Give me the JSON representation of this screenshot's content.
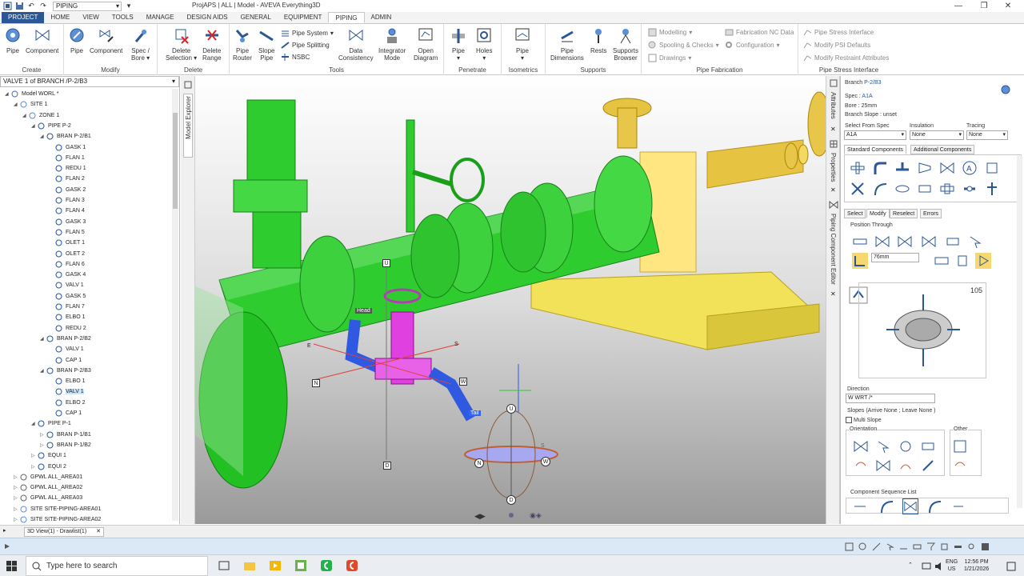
{
  "window": {
    "title": "ProjAPS | ALL | Model - AVEVA Everything3D",
    "module_combo": "PIPING"
  },
  "tabs": [
    "PROJECT",
    "HOME",
    "VIEW",
    "TOOLS",
    "MANAGE",
    "DESIGN AIDS",
    "GENERAL",
    "EQUIPMENT",
    "PIPING",
    "ADMIN"
  ],
  "active_tab": "PIPING",
  "ribbon": {
    "create": {
      "label": "Create",
      "pipe": "Pipe",
      "component": "Component"
    },
    "modify": {
      "label": "Modify",
      "pipe": "Pipe",
      "component": "Component",
      "spec_bore": "Spec /\nBore ▾"
    },
    "delete": {
      "label": "Delete",
      "delete_selection": "Delete\nSelection ▾",
      "delete_range": "Delete\nRange"
    },
    "tools": {
      "label": "Tools",
      "pipe_router": "Pipe\nRouter",
      "slope_pipe": "Slope\nPipe",
      "pipe_system": "Pipe System",
      "pipe_splitting": "Pipe Splitting",
      "nsbc": "NSBC",
      "data_consistency": "Data\nConsistency",
      "integrator_mode": "Integrator\nMode",
      "open_diagram": "Open\nDiagram"
    },
    "penetrate": {
      "label": "Penetrate",
      "pipe": "Pipe\n▾",
      "holes": "Holes\n▾"
    },
    "isometrics": {
      "label": "Isometrics",
      "pipe": "Pipe\n▾"
    },
    "supports": {
      "label": "Supports",
      "pipe_dimensions": "Pipe\nDimensions",
      "rests": "Rests",
      "supports_browser": "Supports\nBrowser"
    },
    "fabrication": {
      "label": "Pipe Fabrication",
      "modelling": "Modelling",
      "spooling": "Spooling & Checks",
      "drawings": "Drawings",
      "fabrication_nc": "Fabrication NC Data",
      "configuration": "Configuration"
    },
    "stress": {
      "label": "Pipe Stress Interface",
      "pipe_stress_interface": "Pipe Stress Interface",
      "modify_psi_defaults": "Modify PSI Defaults",
      "modify_restraint": "Modify Restraint Attributes"
    }
  },
  "explorer": {
    "header": "VALVE 1 of BRANCH /P-2/B3",
    "vertical_label": "Model Explorer",
    "nodes": [
      {
        "label": "Model WORL *",
        "depth": 0,
        "toggle": "◢",
        "icon": "globe"
      },
      {
        "label": "SITE 1",
        "depth": 1,
        "toggle": "◢",
        "icon": "site"
      },
      {
        "label": "ZONE 1",
        "depth": 2,
        "toggle": "◢",
        "icon": "zone"
      },
      {
        "label": "PIPE P-2",
        "depth": 3,
        "toggle": "◢",
        "icon": "pipe"
      },
      {
        "label": "BRAN P-2/B1",
        "depth": 4,
        "toggle": "◢",
        "icon": "branch"
      },
      {
        "label": "GASK 1",
        "depth": 5,
        "toggle": "",
        "icon": "gask"
      },
      {
        "label": "FLAN 1",
        "depth": 5,
        "toggle": "",
        "icon": "flan"
      },
      {
        "label": "REDU 1",
        "depth": 5,
        "toggle": "",
        "icon": "redu"
      },
      {
        "label": "FLAN 2",
        "depth": 5,
        "toggle": "",
        "icon": "flan"
      },
      {
        "label": "GASK 2",
        "depth": 5,
        "toggle": "",
        "icon": "gask"
      },
      {
        "label": "FLAN 3",
        "depth": 5,
        "toggle": "",
        "icon": "flan"
      },
      {
        "label": "FLAN 4",
        "depth": 5,
        "toggle": "",
        "icon": "flan"
      },
      {
        "label": "GASK 3",
        "depth": 5,
        "toggle": "",
        "icon": "gask"
      },
      {
        "label": "FLAN 5",
        "depth": 5,
        "toggle": "",
        "icon": "flan"
      },
      {
        "label": "OLET 1",
        "depth": 5,
        "toggle": "",
        "icon": "olet"
      },
      {
        "label": "OLET 2",
        "depth": 5,
        "toggle": "",
        "icon": "olet"
      },
      {
        "label": "FLAN 6",
        "depth": 5,
        "toggle": "",
        "icon": "flan"
      },
      {
        "label": "GASK 4",
        "depth": 5,
        "toggle": "",
        "icon": "gask"
      },
      {
        "label": "VALV 1",
        "depth": 5,
        "toggle": "",
        "icon": "valv"
      },
      {
        "label": "GASK 5",
        "depth": 5,
        "toggle": "",
        "icon": "gask"
      },
      {
        "label": "FLAN 7",
        "depth": 5,
        "toggle": "",
        "icon": "flan"
      },
      {
        "label": "ELBO 1",
        "depth": 5,
        "toggle": "",
        "icon": "elbo"
      },
      {
        "label": "REDU 2",
        "depth": 5,
        "toggle": "",
        "icon": "redu"
      },
      {
        "label": "BRAN P-2/B2",
        "depth": 4,
        "toggle": "◢",
        "icon": "branch"
      },
      {
        "label": "VALV 1",
        "depth": 5,
        "toggle": "",
        "icon": "valv"
      },
      {
        "label": "CAP 1",
        "depth": 5,
        "toggle": "",
        "icon": "cap"
      },
      {
        "label": "BRAN P-2/B3",
        "depth": 4,
        "toggle": "◢",
        "icon": "branch"
      },
      {
        "label": "ELBO 1",
        "depth": 5,
        "toggle": "",
        "icon": "elbo"
      },
      {
        "label": "VALV 1",
        "depth": 5,
        "toggle": "",
        "icon": "valv",
        "selected": true
      },
      {
        "label": "ELBO 2",
        "depth": 5,
        "toggle": "",
        "icon": "elbo"
      },
      {
        "label": "CAP 1",
        "depth": 5,
        "toggle": "",
        "icon": "cap"
      },
      {
        "label": "PIPE P-1",
        "depth": 3,
        "toggle": "◢",
        "icon": "pipe"
      },
      {
        "label": "BRAN P-1/B1",
        "depth": 4,
        "toggle": "▷",
        "icon": "branch"
      },
      {
        "label": "BRAN P-1/B2",
        "depth": 4,
        "toggle": "▷",
        "icon": "branch"
      },
      {
        "label": "EQUI 1",
        "depth": 3,
        "toggle": "▷",
        "icon": "equi"
      },
      {
        "label": "EQUI 2",
        "depth": 3,
        "toggle": "▷",
        "icon": "equi"
      },
      {
        "label": "GPWL ALL_AREA01",
        "depth": 1,
        "toggle": "▷",
        "icon": "gpwl"
      },
      {
        "label": "GPWL ALL_AREA02",
        "depth": 1,
        "toggle": "▷",
        "icon": "gpwl"
      },
      {
        "label": "GPWL ALL_AREA03",
        "depth": 1,
        "toggle": "▷",
        "icon": "gpwl"
      },
      {
        "label": "SITE SITE-PIPING-AREA01",
        "depth": 1,
        "toggle": "▷",
        "icon": "site"
      },
      {
        "label": "SITE SITE-PIPING-AREA02",
        "depth": 1,
        "toggle": "▷",
        "icon": "site"
      }
    ]
  },
  "viewport": {
    "labels": {
      "head": "Head",
      "tail": "Tail",
      "u": "U",
      "d": "D",
      "e": "E",
      "s": "S",
      "n": "N",
      "w": "W"
    },
    "gizmo": {
      "u": "U",
      "d": "D",
      "n": "N",
      "w": "W",
      "s": "S"
    }
  },
  "right_vtabs": {
    "attributes": "Attributes",
    "properties": "Properties",
    "pce": "Piping Component Editor"
  },
  "editor": {
    "branch_label": "Branch",
    "branch_value": "P-2/B3",
    "spec_label": "Spec :",
    "spec_value": "A1A",
    "bore_label": "Bore :",
    "bore_value": "25mm",
    "slope_label": "Branch Slope :",
    "slope_value": "unset",
    "select_from_spec": "Select From Spec",
    "spec_combo": "A1A",
    "insulation": "Insulation",
    "insulation_combo": "None",
    "tracing": "Tracing",
    "tracing_combo": "None",
    "tab_standard": "Standard Components",
    "tab_additional": "Additional Components",
    "mode_tabs": [
      "Select",
      "Modify",
      "Reselect",
      "Errors"
    ],
    "position_through": "Position Through",
    "distance_value": "76mm",
    "angle_value": "105",
    "direction_label": "Direction",
    "direction_value": "W WRT /*",
    "slopes_text": "Slopes (Arrive None ; Leave None )",
    "multi_slope": "Multi Slope",
    "orientation": "Orientation",
    "other": "Other",
    "sequence": "Component Sequence List"
  },
  "bottom": {
    "doc_tab": "3D View(1) - Drawlist(1)"
  },
  "taskbar": {
    "search_placeholder": "Type here to search",
    "lang1": "ENG",
    "lang2": "US",
    "time": "12:56 PM",
    "date": "1/21/2026"
  },
  "colors": {
    "pipe_green": "#2fcc2f",
    "pump_yellow": "#f5e04a",
    "valve_magenta": "#e040e0",
    "elbow_blue": "#2f59e0",
    "accent": "#2b5797"
  }
}
